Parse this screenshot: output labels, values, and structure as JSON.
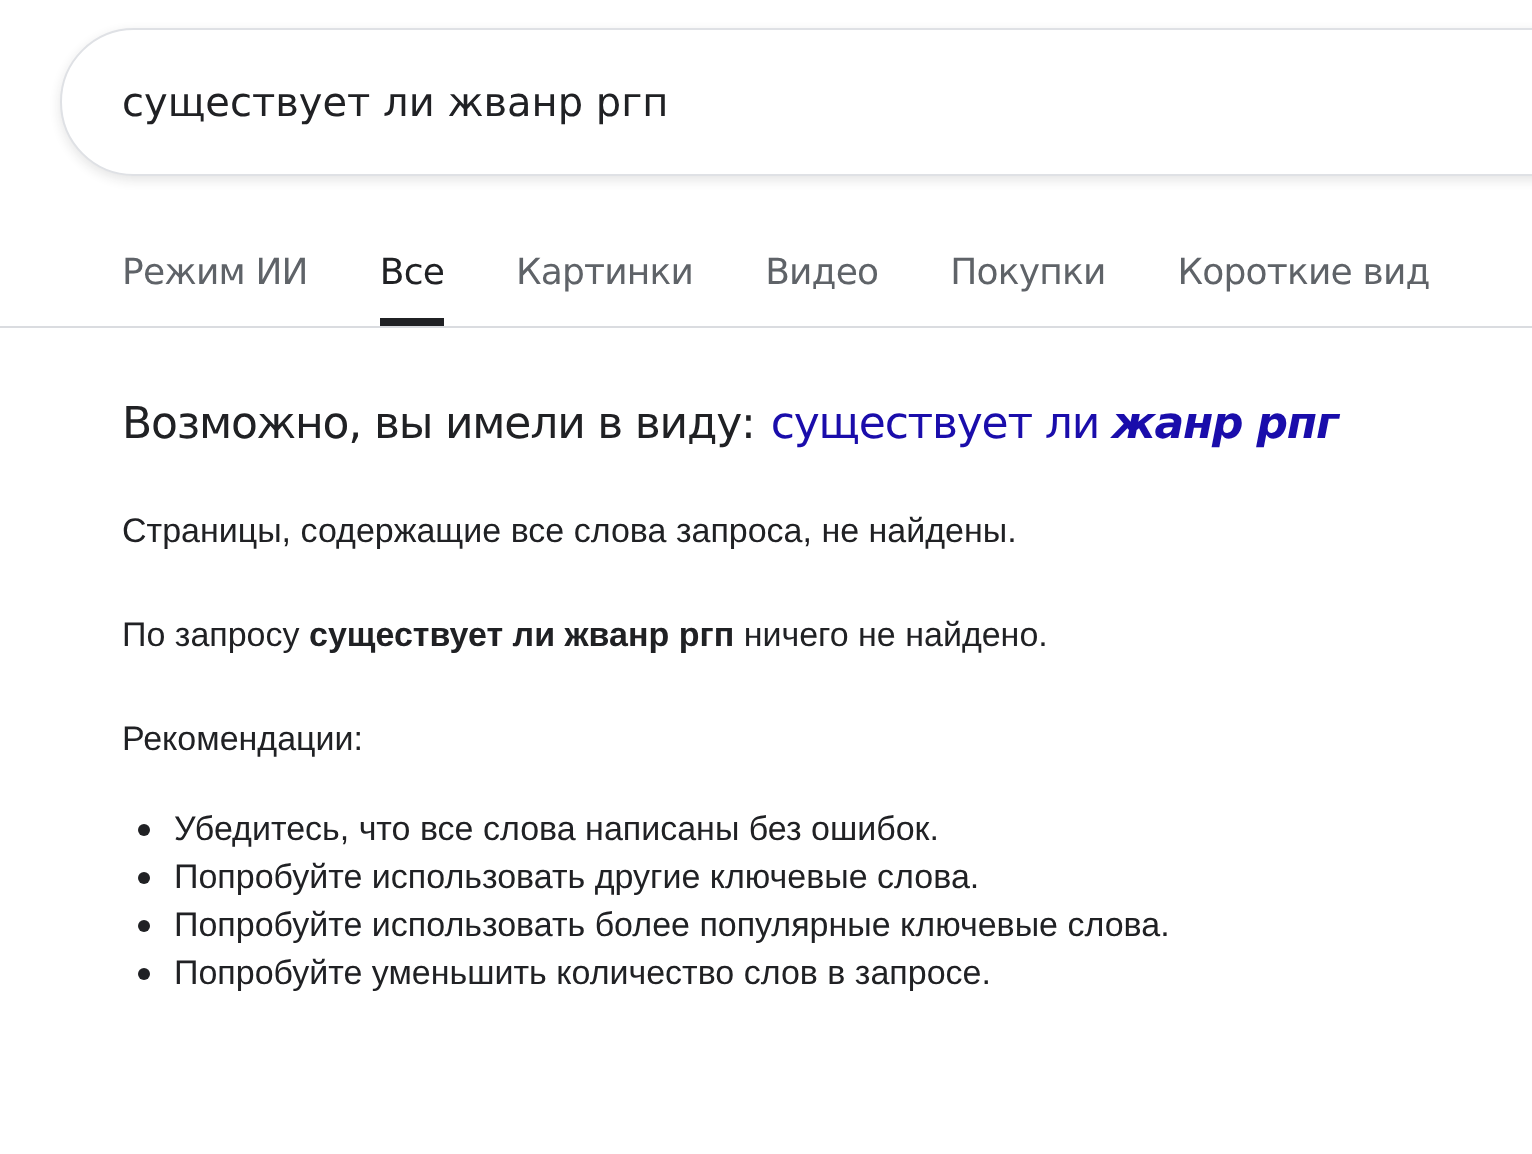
{
  "search": {
    "value": "существует ли жванр ргп"
  },
  "tabs": [
    {
      "label": "Режим ИИ",
      "selected": false
    },
    {
      "label": "Все",
      "selected": true
    },
    {
      "label": "Картинки",
      "selected": false
    },
    {
      "label": "Видео",
      "selected": false
    },
    {
      "label": "Покупки",
      "selected": false
    },
    {
      "label": "Короткие вид",
      "selected": false
    }
  ],
  "suggestion": {
    "prefix": "Возможно, вы имели в виду:",
    "link": "существует ли **жанр рпг**"
  },
  "no_results": "Страницы, содержащие все слова запроса, не найдены.",
  "query_note": "По запросу **существует ли жванр ргп** ничего не найдено.",
  "recommendations_title": "Рекомендации:",
  "recommendations": [
    "Убедитесь, что все слова написаны без ошибок.",
    "Попробуйте использовать другие ключевые слова.",
    "Попробуйте использовать более популярные ключевые слова.",
    "Попробуйте уменьшить количество слов в запросе."
  ]
}
